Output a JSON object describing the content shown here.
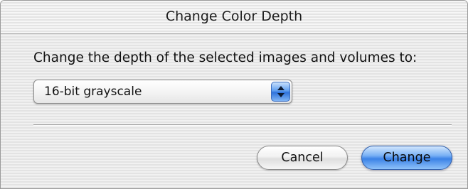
{
  "window": {
    "title": "Change Color Depth"
  },
  "dialog": {
    "prompt": "Change the depth of the selected images and volumes to:",
    "depth_popup": {
      "selected": "16-bit grayscale",
      "icon": "up-down-arrows-icon"
    },
    "buttons": {
      "cancel_label": "Cancel",
      "change_label": "Change"
    }
  },
  "colors": {
    "default_button": "#3b82e6",
    "popup_arrows": "#2e72db"
  }
}
